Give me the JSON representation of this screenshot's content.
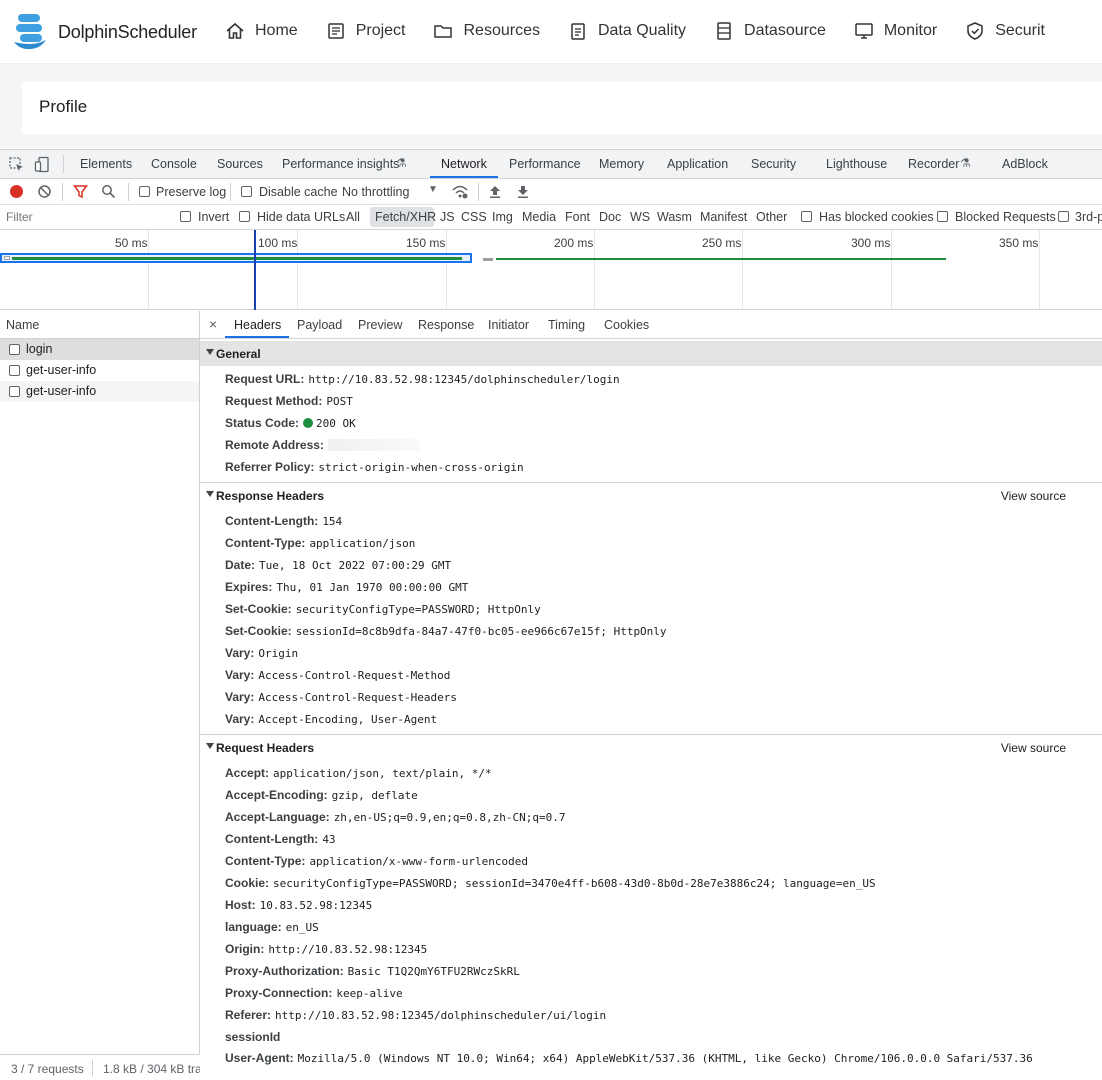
{
  "app": {
    "brand": "DolphinScheduler",
    "nav": [
      {
        "label": "Home",
        "icon": "home-icon"
      },
      {
        "label": "Project",
        "icon": "project-icon"
      },
      {
        "label": "Resources",
        "icon": "folder-icon"
      },
      {
        "label": "Data Quality",
        "icon": "clipboard-icon"
      },
      {
        "label": "Datasource",
        "icon": "database-icon"
      },
      {
        "label": "Monitor",
        "icon": "monitor-icon"
      },
      {
        "label": "Securit",
        "icon": "shield-icon"
      }
    ],
    "profile_title": "Profile"
  },
  "devtools": {
    "tabs": [
      "Elements",
      "Console",
      "Sources",
      "Performance insights",
      "Network",
      "Performance",
      "Memory",
      "Application",
      "Security",
      "Lighthouse",
      "Recorder",
      "AdBlock"
    ],
    "active_tab": "Network",
    "toolbar": {
      "preserve_log": "Preserve log",
      "disable_cache": "Disable cache",
      "throttling": "No throttling"
    },
    "filterbar": {
      "filter_placeholder": "Filter",
      "invert": "Invert",
      "hide_data_urls": "Hide data URLs",
      "types": [
        "All",
        "Fetch/XHR",
        "JS",
        "CSS",
        "Img",
        "Media",
        "Font",
        "Doc",
        "WS",
        "Wasm",
        "Manifest",
        "Other"
      ],
      "active_type": "Fetch/XHR",
      "has_blocked_cookies": "Has blocked cookies",
      "blocked_requests": "Blocked Requests",
      "third_party": "3rd-p"
    },
    "timeline": {
      "ticks": [
        "50 ms",
        "100 ms",
        "150 ms",
        "200 ms",
        "250 ms",
        "300 ms",
        "350 ms"
      ]
    },
    "requests": {
      "header": "Name",
      "items": [
        "login",
        "get-user-info",
        "get-user-info"
      ],
      "status_count": "3 / 7 requests",
      "status_size": "1.8 kB / 304 kB tra"
    },
    "detail_tabs": [
      "Headers",
      "Payload",
      "Preview",
      "Response",
      "Initiator",
      "Timing",
      "Cookies"
    ],
    "active_detail_tab": "Headers",
    "general": {
      "title": "General",
      "rows": [
        {
          "name": "Request URL:",
          "value": "http://10.83.52.98:12345/dolphinscheduler/login"
        },
        {
          "name": "Request Method:",
          "value": "POST"
        },
        {
          "name": "Status Code:",
          "value": "200 OK"
        },
        {
          "name": "Remote Address:",
          "value": ""
        },
        {
          "name": "Referrer Policy:",
          "value": "strict-origin-when-cross-origin"
        }
      ]
    },
    "response_headers": {
      "title": "Response Headers",
      "view_source": "View source",
      "rows": [
        {
          "name": "Content-Length:",
          "value": "154"
        },
        {
          "name": "Content-Type:",
          "value": "application/json"
        },
        {
          "name": "Date:",
          "value": "Tue, 18 Oct 2022 07:00:29 GMT"
        },
        {
          "name": "Expires:",
          "value": "Thu, 01 Jan 1970 00:00:00 GMT"
        },
        {
          "name": "Set-Cookie:",
          "value": "securityConfigType=PASSWORD; HttpOnly"
        },
        {
          "name": "Set-Cookie:",
          "value": "sessionId=8c8b9dfa-84a7-47f0-bc05-ee966c67e15f; HttpOnly"
        },
        {
          "name": "Vary:",
          "value": "Origin"
        },
        {
          "name": "Vary:",
          "value": "Access-Control-Request-Method"
        },
        {
          "name": "Vary:",
          "value": "Access-Control-Request-Headers"
        },
        {
          "name": "Vary:",
          "value": "Accept-Encoding, User-Agent"
        }
      ]
    },
    "request_headers": {
      "title": "Request Headers",
      "view_source": "View source",
      "rows": [
        {
          "name": "Accept:",
          "value": "application/json, text/plain, */*"
        },
        {
          "name": "Accept-Encoding:",
          "value": "gzip, deflate"
        },
        {
          "name": "Accept-Language:",
          "value": "zh,en-US;q=0.9,en;q=0.8,zh-CN;q=0.7"
        },
        {
          "name": "Content-Length:",
          "value": "43"
        },
        {
          "name": "Content-Type:",
          "value": "application/x-www-form-urlencoded"
        },
        {
          "name": "Cookie:",
          "value": "securityConfigType=PASSWORD; sessionId=3470e4ff-b608-43d0-8b0d-28e7e3886c24; language=en_US"
        },
        {
          "name": "Host:",
          "value": "10.83.52.98:12345"
        },
        {
          "name": "language:",
          "value": "en_US"
        },
        {
          "name": "Origin:",
          "value": "http://10.83.52.98:12345"
        },
        {
          "name": "Proxy-Authorization:",
          "value": "Basic T1Q2QmY6TFU2RWczSkRL"
        },
        {
          "name": "Proxy-Connection:",
          "value": "keep-alive"
        },
        {
          "name": "Referer:",
          "value": "http://10.83.52.98:12345/dolphinscheduler/ui/login"
        },
        {
          "name": "sessionId",
          "value": ""
        },
        {
          "name": "User-Agent:",
          "value": "Mozilla/5.0 (Windows NT 10.0; Win64; x64) AppleWebKit/537.36 (KHTML, like Gecko) Chrome/106.0.0.0 Safari/537.36"
        }
      ]
    }
  },
  "colors": {
    "accent": "#1a73e8",
    "status_ok": "#1e8e3e",
    "record": "#d93025",
    "brand_blue": "#3ea0e0"
  }
}
